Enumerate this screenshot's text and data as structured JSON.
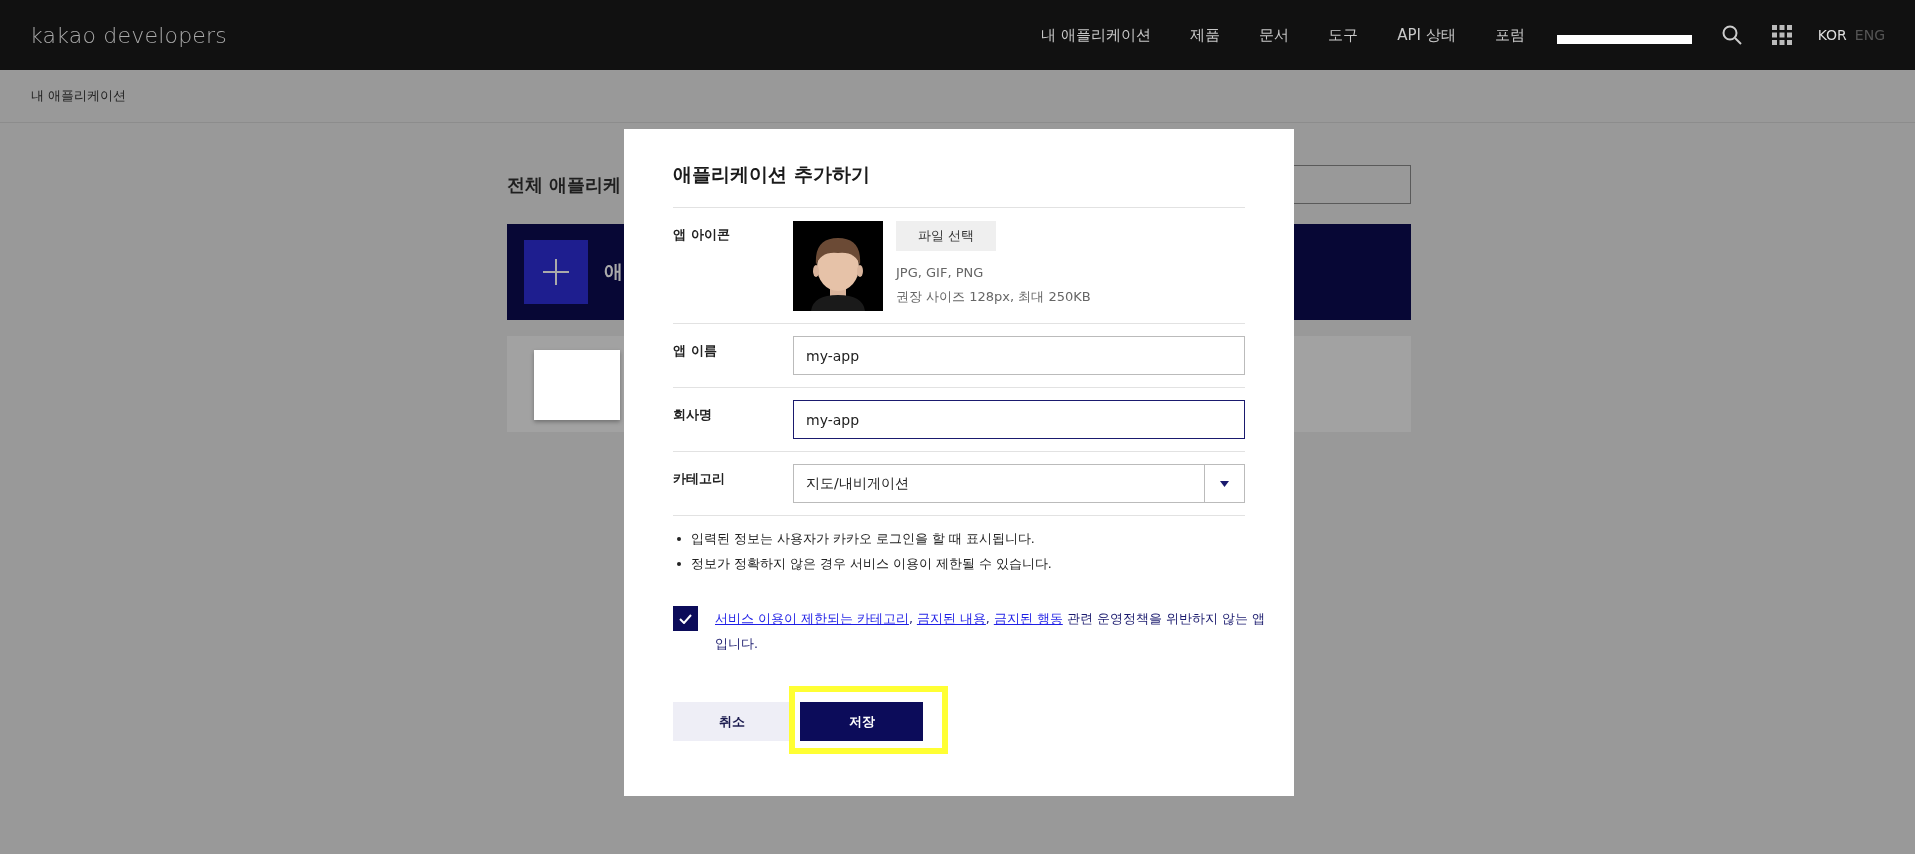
{
  "header": {
    "logo": "kakao developers",
    "nav": [
      "내 애플리케이션",
      "제품",
      "문서",
      "도구",
      "API 상태",
      "포럼"
    ],
    "languages": [
      {
        "label": "KOR",
        "selected": true
      },
      {
        "label": "ENG",
        "selected": false
      }
    ]
  },
  "background": {
    "breadcrumb": "내 애플리케이션",
    "page_title": "전체 애플리케",
    "banner_text": "애"
  },
  "dialog": {
    "title": "애플리케이션 추가하기",
    "fields": [
      {
        "label": "앱 아이콘",
        "button": "파일 선택",
        "hints": [
          "JPG, GIF, PNG",
          "권장 사이즈 128px, 최대 250KB"
        ]
      },
      {
        "label": "앱 이름",
        "kind": "text",
        "value": "my-app",
        "focused": false
      },
      {
        "label": "회사명",
        "kind": "text",
        "value": "my-app",
        "focused": true
      },
      {
        "label": "카테고리",
        "kind": "select",
        "value": "지도/내비게이션"
      }
    ],
    "notes": [
      "입력된 정보는 사용자가 카카오 로그인을 할 때 표시됩니다.",
      "정보가 정확하지 않은 경우 서비스 이용이 제한될 수 있습니다."
    ],
    "agreement": {
      "checked": true,
      "parts": [
        {
          "kind": "link",
          "text": "서비스 이용이 제한되는 카테고리"
        },
        {
          "kind": "plain",
          "text": ", "
        },
        {
          "kind": "link",
          "text": "금지된 내용"
        },
        {
          "kind": "plain",
          "text": ", "
        },
        {
          "kind": "link",
          "text": "금지된 행동"
        },
        {
          "kind": "plain",
          "text": " 관련 운영정책을 위반하지 않는 앱입니다."
        }
      ]
    },
    "buttons": [
      {
        "label": "취소",
        "kind": "secondary",
        "highlighted": false
      },
      {
        "label": "저장",
        "kind": "primary",
        "highlighted": true
      }
    ]
  }
}
